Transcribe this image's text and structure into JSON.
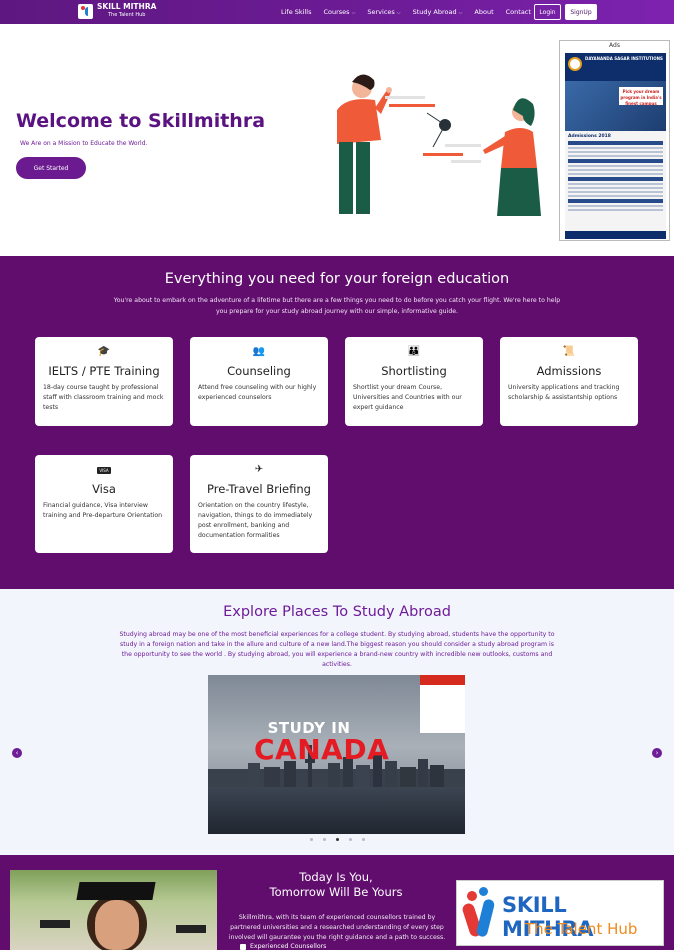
{
  "nav": {
    "logo_title": "SKILL MITHRA",
    "logo_subtitle": "The Talent Hub",
    "menu": [
      {
        "label": "Life Skills"
      },
      {
        "label": "Courses",
        "dropdown": "⌵"
      },
      {
        "label": "Services",
        "dropdown": "⌵"
      },
      {
        "label": "Study Abroad",
        "dropdown": "⌵"
      },
      {
        "label": "About"
      },
      {
        "label": "Contact"
      }
    ],
    "login_label": "Login",
    "signup_label": "SignUp"
  },
  "hero": {
    "title": "Welcome to Skillmithra",
    "subtitle": "We Are on a Mission to Educate the World.",
    "cta_label": "Get Started"
  },
  "ads": {
    "label": "Ads",
    "poster_heading": "DAYANANDA SAGAR INSTITUTIONS",
    "poster_tag": "Pick your dream program in India's finest campus",
    "poster_admissions": "Admissions 2018"
  },
  "services": {
    "title": "Everything you need for your foreign education",
    "description": "You're about to embark on the adventure of a lifetime but there are a few things you need to do before you catch your flight. We're here to help you prepare for your study abroad journey with our simple, informative guide.",
    "cards": [
      {
        "icon": "graduation-cap-icon",
        "title": "IELTS / PTE Training",
        "desc": "18-day course taught by professional staff with classroom training and mock tests"
      },
      {
        "icon": "people-talk-icon",
        "title": "Counseling",
        "desc": "Attend free counseling with our highly experienced counselors"
      },
      {
        "icon": "people-group-icon",
        "title": "Shortlisting",
        "desc": "Shortlist your dream Course, Universities and Countries with our expert guidance"
      },
      {
        "icon": "scroll-icon",
        "title": "Admissions",
        "desc": "University applications and tracking scholarship & assistantship options"
      },
      {
        "icon": "visa-card-icon",
        "icon_text": "VISA",
        "title": "Visa",
        "desc": "Financial guidance, Visa interview training and Pre-departure Orientation"
      },
      {
        "icon": "airplane-icon",
        "title": "Pre-Travel Briefing",
        "desc": "Orientation on the country lifestyle, navigation, things to do immediately post enrollment, banking and documentation formalities"
      }
    ]
  },
  "explore": {
    "title": "Explore Places To Study Abroad",
    "description": "Studying abroad may be one of the most beneficial experiences for a college student. By studying abroad, students have the opportunity to study in a foreign nation and take in the allure and culture of a new land.The biggest reason you should consider a study abroad program is the opportunity to see the world . By studying abroad, you will experience a brand-new country with incredible new outlooks, customs and activities.",
    "slide_line1": "STUDY IN",
    "slide_line2": "CANADA",
    "prev_icon": "‹",
    "next_icon": "›",
    "slide_count": 5,
    "active_slide": 3
  },
  "bottom": {
    "title_line1": "Today Is You,",
    "title_line2": "Tomorrow Will Be Yours",
    "description": "Skillmithra, with its team of experienced counsellors trained by partnered universities and a researched understanding of every step involved will gaurantee you the right guidance and a path to success.",
    "checklist": [
      "Experienced Counsellors"
    ],
    "brand_name": "SKILL MITHRA",
    "brand_tagline": "The Talent Hub"
  },
  "colors": {
    "brand_purple": "#610d6e",
    "accent_purple": "#6e1c98",
    "canada_red": "#e41b23"
  }
}
